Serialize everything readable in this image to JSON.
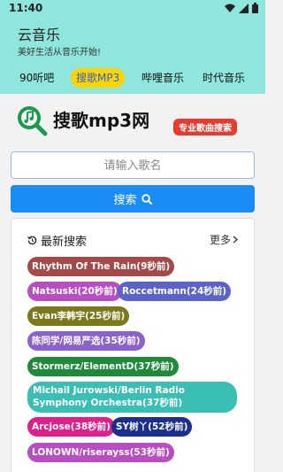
{
  "status": {
    "time": "11:40"
  },
  "header": {
    "title": "云音乐",
    "subtitle": "美好生活从音乐开始!"
  },
  "tabs": [
    {
      "label": "90听吧",
      "active": false
    },
    {
      "label": "搜歌MP3",
      "active": true
    },
    {
      "label": "哔哩音乐",
      "active": false
    },
    {
      "label": "时代音乐",
      "active": false
    }
  ],
  "logo": {
    "text": "搜歌mp3网",
    "badge": "专业歌曲搜索"
  },
  "search": {
    "placeholder": "请输入歌名",
    "button_label": "搜索"
  },
  "recent": {
    "title": "最新搜索",
    "more_label": "更多",
    "items": [
      {
        "label": "Rhythm Of The Rain(9秒前)",
        "color": "#a24b4a"
      },
      {
        "label": "Natsuski(20秒前)",
        "color": "#b84fc0"
      },
      {
        "label": "Roccetmann(24秒前)",
        "color": "#5b63c8"
      },
      {
        "label": "Evan李韩宇(25秒前)",
        "color": "#7a7a1c"
      },
      {
        "label": "陈同学/网易严选(35秒前)",
        "color": "#8b62c9"
      },
      {
        "label": "Stormerz/ElementD(37秒前)",
        "color": "#1f8a3a"
      },
      {
        "label": "Michail Jurowski/Berlin Radio Symphony Orchestra(37秒前)",
        "color": "#3bbfb4"
      },
      {
        "label": "Arcjose(38秒前)",
        "color": "#e0208a"
      },
      {
        "label": "SY树丫(52秒前)",
        "color": "#1d2f8c"
      },
      {
        "label": "LONOWN/riserayss(53秒前)",
        "color": "#b84fc0"
      }
    ]
  }
}
